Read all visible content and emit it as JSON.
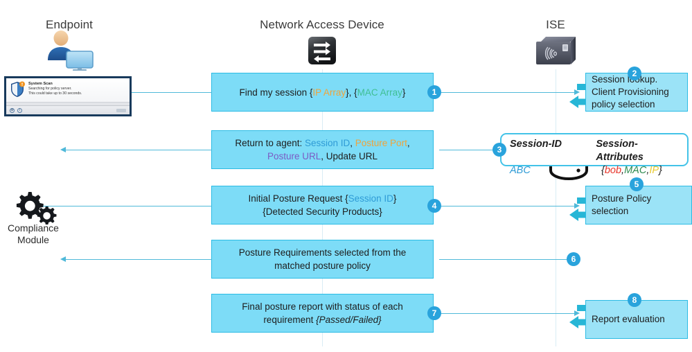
{
  "columns": [
    {
      "id": "endpoint",
      "title": "Endpoint"
    },
    {
      "id": "nad",
      "title": "Network Access Device"
    },
    {
      "id": "ise",
      "title": "ISE"
    }
  ],
  "icons": {
    "endpoint": "user-computer-icon",
    "nad": "network-switch-icon",
    "ise": "ise-server-fingerprint-icon",
    "compliance": "gears-icon",
    "database": "database-cylinder-icon"
  },
  "endpoint_window": {
    "title": "System Scan",
    "line1": "Searching for policy server.",
    "line2": "This could take up to 30 seconds.",
    "shield_icon": "shield-icon",
    "gear_icon": "gear-icon",
    "info_icon": "info-icon"
  },
  "compliance": {
    "line1": "Compliance",
    "line2": "Module"
  },
  "messages": [
    {
      "id": "find-session",
      "badge": "1",
      "line1_parts": [
        {
          "text": "Find my session {",
          "color": "dark"
        },
        {
          "text": "IP Array",
          "color": "orange"
        },
        {
          "text": "}, {",
          "color": "dark"
        },
        {
          "text": "MAC Array",
          "color": "green"
        },
        {
          "text": "}",
          "color": "dark"
        }
      ]
    },
    {
      "id": "return-to-agent",
      "badge": "",
      "line1_parts": [
        {
          "text": "Return to agent: ",
          "color": "dark"
        },
        {
          "text": "Session ID",
          "color": "blue"
        },
        {
          "text": ", ",
          "color": "dark"
        },
        {
          "text": "Posture Port",
          "color": "orange"
        },
        {
          "text": ",",
          "color": "dark"
        }
      ],
      "line2_parts": [
        {
          "text": "Posture URL",
          "color": "purple"
        },
        {
          "text": ", Update URL",
          "color": "dark"
        }
      ]
    },
    {
      "id": "initial-posture-request",
      "badge": "4",
      "line1_parts": [
        {
          "text": "Initial Posture Request {",
          "color": "dark"
        },
        {
          "text": "Session ID",
          "color": "blue"
        },
        {
          "text": "}",
          "color": "dark"
        }
      ],
      "line2_parts": [
        {
          "text": "{Detected Security Products}",
          "color": "dark"
        }
      ]
    },
    {
      "id": "posture-requirements",
      "badge": "6",
      "line1_parts": [
        {
          "text": "Posture Requirements selected from the",
          "color": "dark"
        }
      ],
      "line2_parts": [
        {
          "text": "matched posture policy",
          "color": "dark"
        }
      ]
    },
    {
      "id": "final-posture-report",
      "badge": "7",
      "line1_parts": [
        {
          "text": "Final posture report with status of each",
          "color": "dark"
        }
      ],
      "line2_parts": [
        {
          "text": "requirement ",
          "color": "dark"
        },
        {
          "text": "{Passed/Failed}",
          "color": "dark",
          "italic": true
        }
      ]
    }
  ],
  "ise_boxes": [
    {
      "id": "session-lookup",
      "badge": "2",
      "lines": [
        "Session lookup.",
        "Client Provisioning",
        "policy selection"
      ]
    },
    {
      "id": "posture-policy-selection",
      "badge": "5",
      "lines": [
        "Posture Policy",
        "selection"
      ]
    },
    {
      "id": "report-evaluation",
      "badge": "8",
      "lines": [
        "Report evaluation"
      ]
    }
  ],
  "session_table": {
    "badge": "3",
    "header_col1": "Session-ID",
    "header_col2": "Session-Attributes",
    "value_col1": "ABC",
    "value_col2_parts": [
      {
        "text": "{",
        "color": "dark"
      },
      {
        "text": "bob",
        "color": "red"
      },
      {
        "text": ",",
        "color": "dark"
      },
      {
        "text": "MAC",
        "color": "mgreen"
      },
      {
        "text": ",",
        "color": "dark"
      },
      {
        "text": "IP",
        "color": "yellow"
      },
      {
        "text": "}",
        "color": "dark"
      }
    ]
  },
  "colors": {
    "box_fill": "#7DDCF7",
    "box_border": "#2BBBE4",
    "ise_box_fill": "#9BE3F7",
    "badge": "#29A3DC",
    "connector": "#4FB9D9",
    "fat_arrow": "#27B6D6",
    "table_border": "#43C3E8"
  }
}
